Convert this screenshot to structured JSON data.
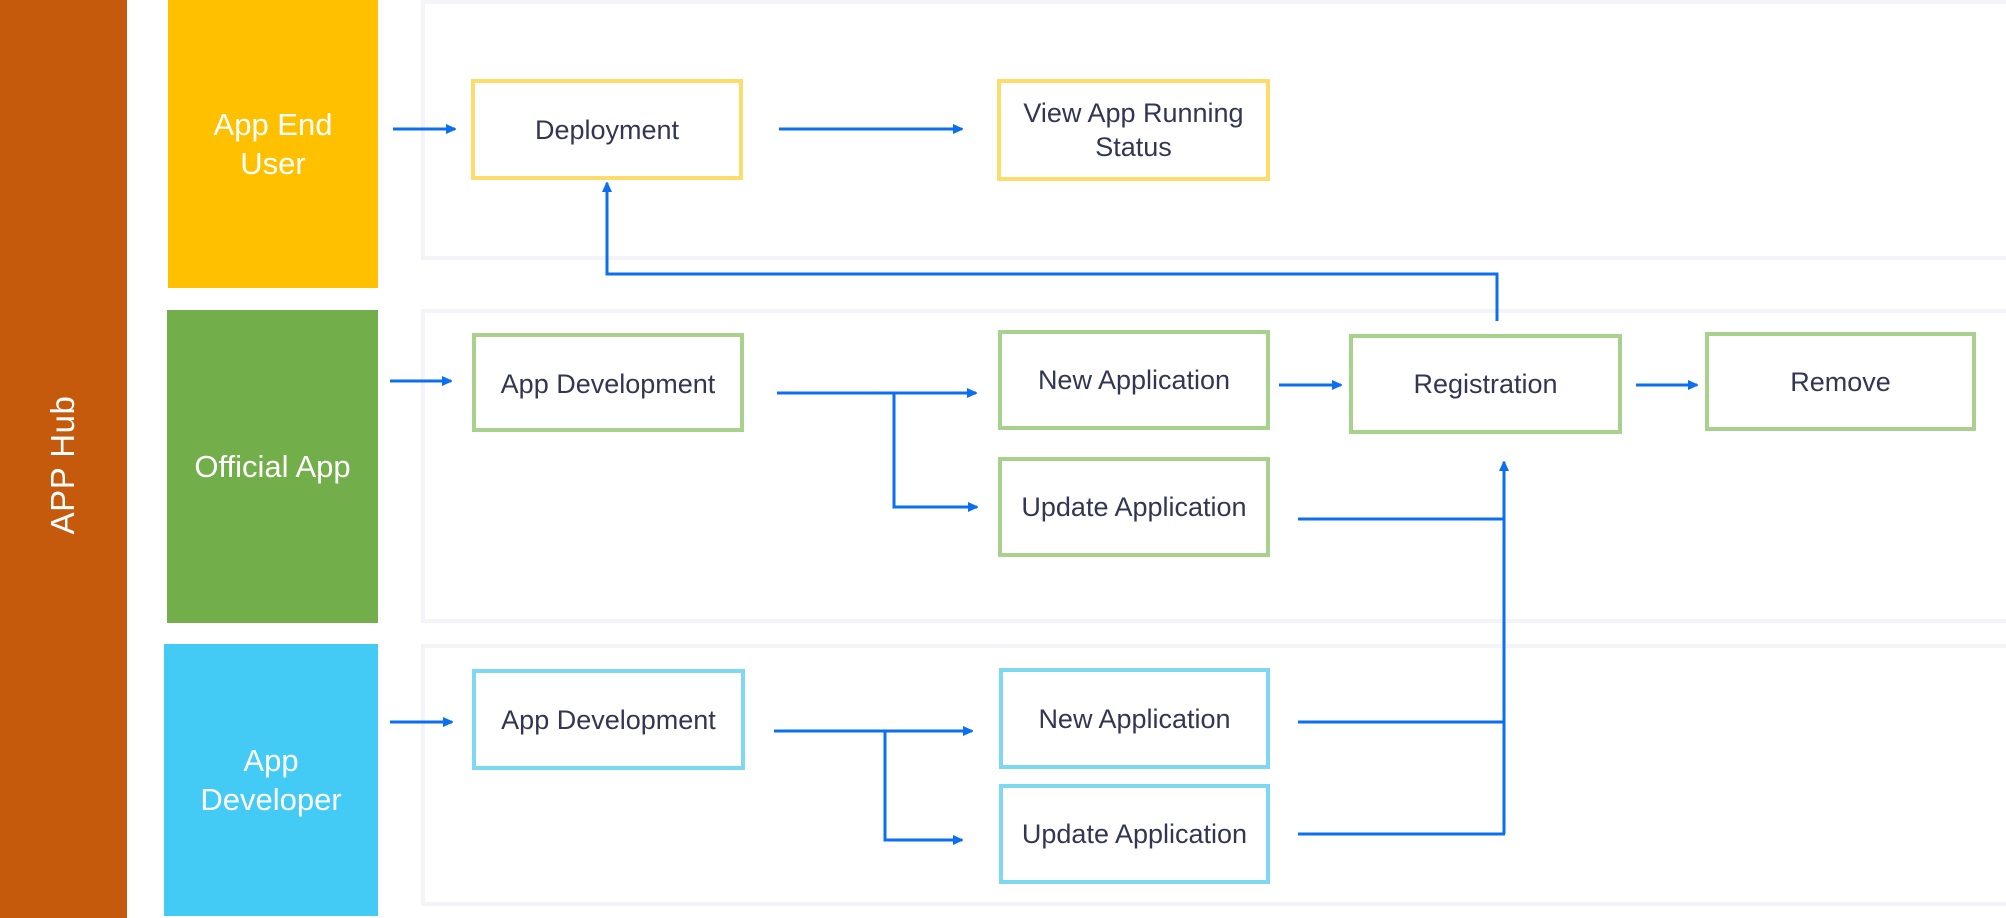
{
  "hub": {
    "label": "APP Hub",
    "color": "#c55a0d"
  },
  "lanes": [
    {
      "id": "end-user",
      "label": "App End User",
      "color": "#ffc000"
    },
    {
      "id": "official",
      "label": "Official App",
      "color": "#72ae4a"
    },
    {
      "id": "developer",
      "label": "App Developer",
      "color": "#43cbf5"
    }
  ],
  "nodes": {
    "deployment": "Deployment",
    "view_status": "View App Running Status",
    "official_app_dev": "App Development",
    "official_new_app": "New Application",
    "official_update_app": "Update Application",
    "registration": "Registration",
    "remove": "Remove",
    "dev_app_dev": "App Development",
    "dev_new_app": "New Application",
    "dev_update_app": "Update Application"
  },
  "colors": {
    "arrow": "#0b6ff0",
    "node_text": "#333652",
    "yellow_border": "#fddc6b",
    "green_border": "#a9d18e",
    "blue_border": "#7fd8f2",
    "panel_border": "#f3f3f9"
  },
  "edges": [
    {
      "from": "end-user-lane",
      "to": "deployment"
    },
    {
      "from": "deployment",
      "to": "view_status"
    },
    {
      "from": "registration",
      "to": "deployment"
    },
    {
      "from": "official-lane",
      "to": "official_app_dev"
    },
    {
      "from": "official_app_dev",
      "to": "official_new_app"
    },
    {
      "from": "official_app_dev",
      "to": "official_update_app"
    },
    {
      "from": "official_new_app",
      "to": "registration"
    },
    {
      "from": "registration",
      "to": "remove"
    },
    {
      "from": "official_update_app",
      "to": "registration"
    },
    {
      "from": "developer-lane",
      "to": "dev_app_dev"
    },
    {
      "from": "dev_app_dev",
      "to": "dev_new_app"
    },
    {
      "from": "dev_app_dev",
      "to": "dev_update_app"
    },
    {
      "from": "dev_new_app",
      "to": "registration"
    },
    {
      "from": "dev_update_app",
      "to": "registration"
    }
  ]
}
